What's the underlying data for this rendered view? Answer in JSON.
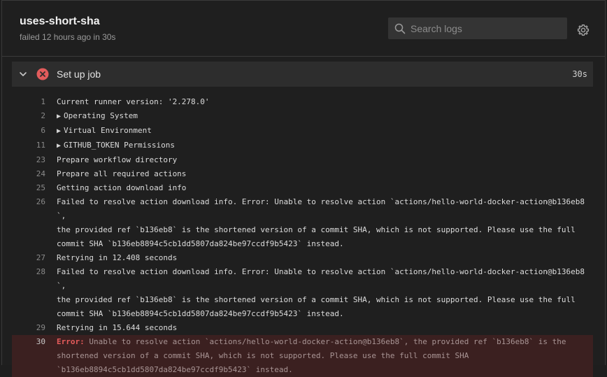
{
  "job": {
    "title": "uses-short-sha",
    "subtitle": "failed 12 hours ago in 30s"
  },
  "search": {
    "placeholder": "Search logs"
  },
  "step": {
    "name": "Set up job",
    "duration": "30s",
    "status": "failed"
  },
  "log": {
    "lines": [
      {
        "n": "1",
        "text": "Current runner version: '2.278.0'"
      },
      {
        "n": "2",
        "text": "Operating System",
        "group": true
      },
      {
        "n": "6",
        "text": "Virtual Environment",
        "group": true
      },
      {
        "n": "11",
        "text": "GITHUB_TOKEN Permissions",
        "group": true
      },
      {
        "n": "23",
        "text": "Prepare workflow directory"
      },
      {
        "n": "24",
        "text": "Prepare all required actions"
      },
      {
        "n": "25",
        "text": "Getting action download info"
      },
      {
        "n": "26",
        "text": "Failed to resolve action download info. Error: Unable to resolve action `actions/hello-world-docker-action@b136eb8`,\nthe provided ref `b136eb8` is the shortened version of a commit SHA, which is not supported. Please use the full\ncommit SHA `b136eb8894c5cb1dd5807da824be97ccdf9b5423` instead."
      },
      {
        "n": "27",
        "text": "Retrying in 12.408 seconds"
      },
      {
        "n": "28",
        "text": "Failed to resolve action download info. Error: Unable to resolve action `actions/hello-world-docker-action@b136eb8`,\nthe provided ref `b136eb8` is the shortened version of a commit SHA, which is not supported. Please use the full\ncommit SHA `b136eb8894c5cb1dd5807da824be97ccdf9b5423` instead."
      },
      {
        "n": "29",
        "text": "Retrying in 15.644 seconds"
      },
      {
        "n": "30",
        "error_label": "Error:",
        "text": " Unable to resolve action `actions/hello-world-docker-action@b136eb8`, the provided ref `b136eb8` is the\nshortened version of a commit SHA, which is not supported. Please use the full commit SHA\n`b136eb8894c5cb1dd5807da824be97ccdf9b5423` instead.",
        "error": true
      }
    ]
  },
  "colors": {
    "background": "#1e1e1e",
    "error_red": "#e55b5b",
    "error_row_bg": "#3b2020"
  }
}
